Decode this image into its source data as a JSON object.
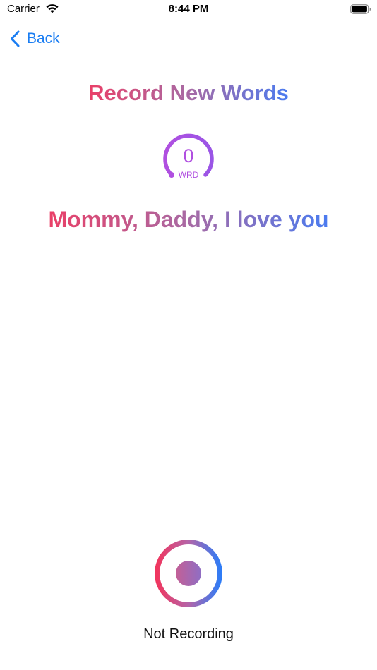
{
  "status_bar": {
    "carrier": "Carrier",
    "time": "8:44 PM",
    "wifi_icon": "wifi-icon",
    "battery_icon": "battery-full-icon"
  },
  "nav": {
    "back_label": "Back",
    "back_icon": "chevron-left-icon"
  },
  "title": "Record New Words",
  "word_gauge": {
    "value": "0",
    "unit": "WRD"
  },
  "phrase": "Mommy, Daddy, I love you",
  "recorder": {
    "status": "Not Recording",
    "icon": "record-icon"
  },
  "colors": {
    "accent_blue": "#1a7df2",
    "gradient_start": "#ea3f67",
    "gradient_mid": "#a86aa4",
    "gradient_end": "#4a7bf0",
    "gauge_purple": "#b04fe0"
  }
}
